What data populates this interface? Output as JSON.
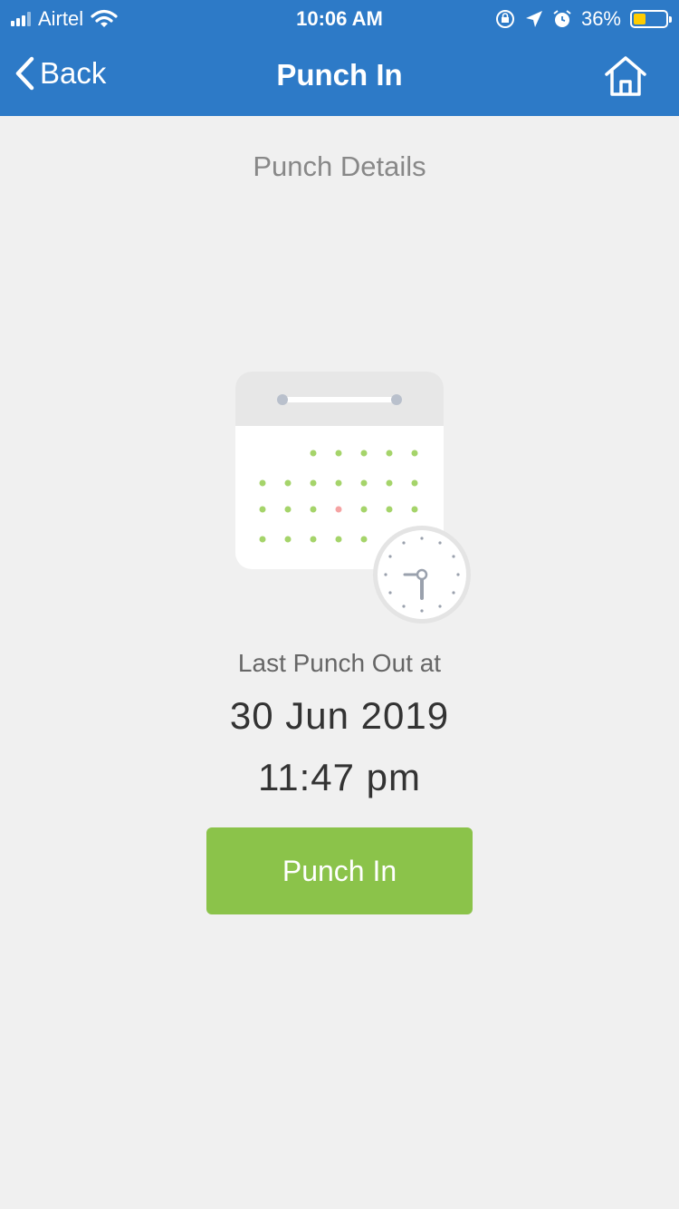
{
  "status_bar": {
    "carrier": "Airtel",
    "time": "10:06 AM",
    "battery": "36%",
    "battery_color": "#ffcc00"
  },
  "nav": {
    "back_label": "Back",
    "title": "Punch In",
    "home_icon": "home-icon"
  },
  "content": {
    "section_title": "Punch Details",
    "last_label": "Last Punch Out at",
    "last_date": "30 Jun 2019",
    "last_time": "11:47 pm",
    "button_label": "Punch In",
    "button_color": "#8bc34a",
    "header_color": "#2d7ac7"
  }
}
